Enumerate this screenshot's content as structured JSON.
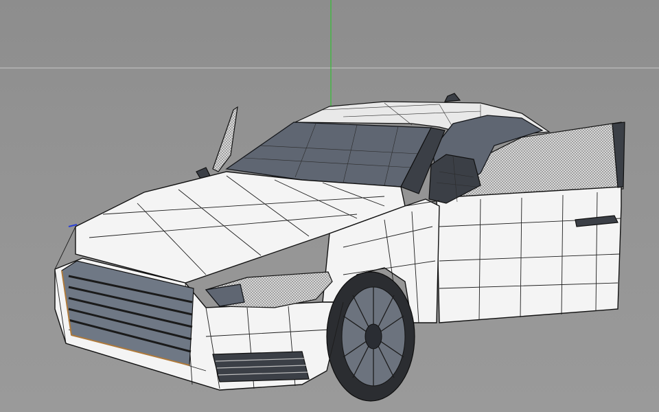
{
  "viewport": {
    "background": "#8f8f8f",
    "axis_colors": {
      "y_axis": "#33c033",
      "x_axis": "#c8c8c8",
      "z_axis": "#2a3fd6"
    }
  },
  "model": {
    "subject": "sedan-wireframe-mesh",
    "colors": {
      "body": "#f4f4f4",
      "wire": "#1c1c1c",
      "glass": "#5f6672",
      "grille": "#6f7885"
    }
  }
}
